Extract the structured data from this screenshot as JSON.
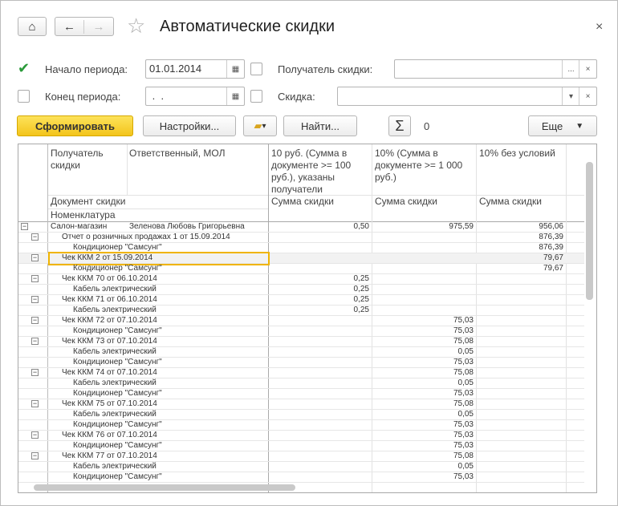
{
  "window": {
    "title": "Автоматические скидки",
    "close": "×"
  },
  "nav": {
    "home": "⌂",
    "back": "←",
    "forward": "→",
    "favorite": "☆"
  },
  "filters": {
    "period_start": {
      "checked": true,
      "label": "Начало периода:",
      "value": "01.01.2014"
    },
    "period_end": {
      "checked": false,
      "label": "Конец периода:",
      "value": " .  ."
    },
    "recipient": {
      "checked": false,
      "label": "Получатель скидки:",
      "value": "",
      "select": "...",
      "clear": "×"
    },
    "discount": {
      "checked": false,
      "label": "Скидка:",
      "value": "",
      "select": "▾",
      "clear": "×"
    }
  },
  "toolbar": {
    "generate": "Сформировать",
    "settings": "Настройки...",
    "find": "Найти...",
    "sum_icon": "Σ",
    "sum_value": "0",
    "more": "Еще"
  },
  "colors": {
    "accent": "#f5c518",
    "selection": "#f0b400"
  },
  "table": {
    "headers": {
      "recipient": "Получатель скидки",
      "responsible": "Ответственный, МОЛ",
      "c1": "10 руб. (Сумма в документе >= 100 руб.), указаны получатели",
      "c2": "10% (Сумма в документе >= 1 000 руб.)",
      "c3": "10% без условий",
      "document": "Документ скидки",
      "item": "Номенклатура",
      "sum1": "Сумма скидки",
      "sum2": "Сумма скидки",
      "sum3": "Сумма скидки"
    },
    "rows": [
      {
        "level": 0,
        "text": "Салон-магазин",
        "resp": "Зеленова Любовь Григорьевна",
        "v1": "0,50",
        "v2": "975,59",
        "v3": "956,06"
      },
      {
        "level": 1,
        "text": "Отчет о розничных продажах 1 от 15.09.2014",
        "v1": "",
        "v2": "",
        "v3": "876,39"
      },
      {
        "level": 2,
        "text": "Кондиционер \"Самсунг\"",
        "v1": "",
        "v2": "",
        "v3": "876,39"
      },
      {
        "level": 1,
        "text": "Чек ККМ 2 от 15.09.2014",
        "v1": "",
        "v2": "",
        "v3": "79,67",
        "selected": true
      },
      {
        "level": 2,
        "text": "Кондиционер \"Самсунг\"",
        "v1": "",
        "v2": "",
        "v3": "79,67"
      },
      {
        "level": 1,
        "text": "Чек ККМ 70 от 06.10.2014",
        "v1": "0,25",
        "v2": "",
        "v3": ""
      },
      {
        "level": 2,
        "text": "Кабель электрический",
        "v1": "0,25",
        "v2": "",
        "v3": ""
      },
      {
        "level": 1,
        "text": "Чек ККМ 71 от 06.10.2014",
        "v1": "0,25",
        "v2": "",
        "v3": ""
      },
      {
        "level": 2,
        "text": "Кабель электрический",
        "v1": "0,25",
        "v2": "",
        "v3": ""
      },
      {
        "level": 1,
        "text": "Чек ККМ 72 от 07.10.2014",
        "v1": "",
        "v2": "75,03",
        "v3": ""
      },
      {
        "level": 2,
        "text": "Кондиционер \"Самсунг\"",
        "v1": "",
        "v2": "75,03",
        "v3": ""
      },
      {
        "level": 1,
        "text": "Чек ККМ 73 от 07.10.2014",
        "v1": "",
        "v2": "75,08",
        "v3": ""
      },
      {
        "level": 2,
        "text": "Кабель электрический",
        "v1": "",
        "v2": "0,05",
        "v3": ""
      },
      {
        "level": 2,
        "text": "Кондиционер \"Самсунг\"",
        "v1": "",
        "v2": "75,03",
        "v3": ""
      },
      {
        "level": 1,
        "text": "Чек ККМ 74 от 07.10.2014",
        "v1": "",
        "v2": "75,08",
        "v3": ""
      },
      {
        "level": 2,
        "text": "Кабель электрический",
        "v1": "",
        "v2": "0,05",
        "v3": ""
      },
      {
        "level": 2,
        "text": "Кондиционер \"Самсунг\"",
        "v1": "",
        "v2": "75,03",
        "v3": ""
      },
      {
        "level": 1,
        "text": "Чек ККМ 75 от 07.10.2014",
        "v1": "",
        "v2": "75,08",
        "v3": ""
      },
      {
        "level": 2,
        "text": "Кабель электрический",
        "v1": "",
        "v2": "0,05",
        "v3": ""
      },
      {
        "level": 2,
        "text": "Кондиционер \"Самсунг\"",
        "v1": "",
        "v2": "75,03",
        "v3": ""
      },
      {
        "level": 1,
        "text": "Чек ККМ 76 от 07.10.2014",
        "v1": "",
        "v2": "75,03",
        "v3": ""
      },
      {
        "level": 2,
        "text": "Кондиционер \"Самсунг\"",
        "v1": "",
        "v2": "75,03",
        "v3": ""
      },
      {
        "level": 1,
        "text": "Чек ККМ 77 от 07.10.2014",
        "v1": "",
        "v2": "75,08",
        "v3": ""
      },
      {
        "level": 2,
        "text": "Кабель электрический",
        "v1": "",
        "v2": "0,05",
        "v3": ""
      },
      {
        "level": 2,
        "text": "Кондиционер \"Самсунг\"",
        "v1": "",
        "v2": "75,03",
        "v3": ""
      }
    ]
  }
}
